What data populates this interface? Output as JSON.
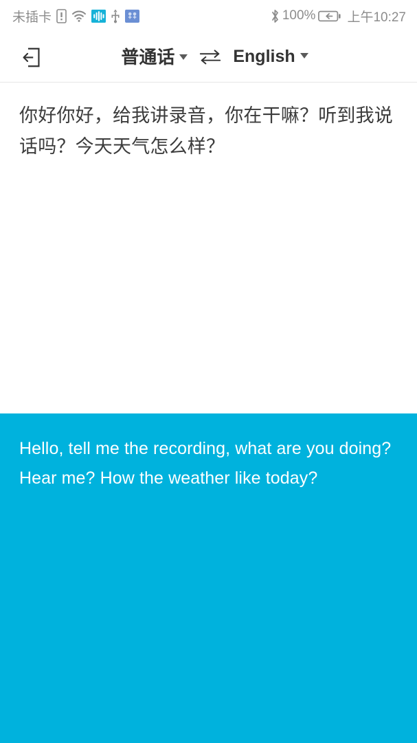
{
  "theme": {
    "accent_color": "#00b2dd",
    "source_text_color": "#3c3c3c",
    "target_text_color": "#ffffff",
    "statusbar_text_color": "#8c8c8c",
    "divider_color": "#e6e6e6"
  },
  "statusbar": {
    "sim_status": "未插卡",
    "icons_left": [
      "sim-card-alert-icon",
      "wifi-icon",
      "audio-recording-icon",
      "usb-icon",
      "dual-app-icon"
    ],
    "bluetooth_icon": "bluetooth-icon",
    "battery_percent": "100%",
    "battery_icon": "battery-charging-icon",
    "clock": "上午10:27"
  },
  "toolbar": {
    "exit_icon": "exit-icon",
    "source_language": "普通话",
    "source_caret_icon": "chevron-down-icon",
    "swap_icon": "swap-horizontal-icon",
    "target_language": "English",
    "target_caret_icon": "chevron-down-icon"
  },
  "source": {
    "text": "你好你好，给我讲录音，你在干嘛？听到我说话吗？今天天气怎么样？"
  },
  "target": {
    "text": "Hello, tell me the recording, what are you doing? Hear me? How the weather like today?"
  }
}
